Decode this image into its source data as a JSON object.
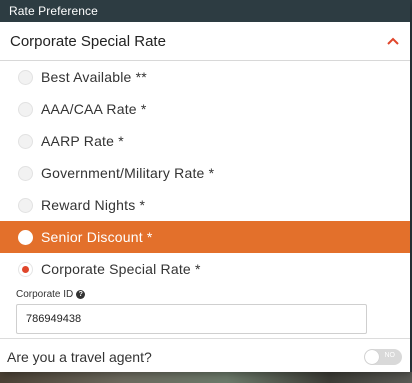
{
  "header": {
    "title": "Rate Preference"
  },
  "select": {
    "value": "Corporate Special Rate",
    "icon": "chevron-up-icon",
    "accent": "#e0462b"
  },
  "options": [
    {
      "label": "Best Available **"
    },
    {
      "label": "AAA/CAA Rate *"
    },
    {
      "label": "AARP Rate *"
    },
    {
      "label": "Government/Military Rate *"
    },
    {
      "label": "Reward Nights *"
    },
    {
      "label": "Senior Discount *",
      "highlighted": true
    },
    {
      "label": "Corporate Special Rate *",
      "selected": true
    }
  ],
  "corporate_id": {
    "label": "Corporate ID",
    "value": "786949438"
  },
  "travel_agent": {
    "label": "Are you a travel agent?",
    "toggle_text": "NO",
    "on": false
  },
  "colors": {
    "header": "#2d3c42",
    "highlight": "#e3702b",
    "selected_dot": "#e0462b"
  }
}
